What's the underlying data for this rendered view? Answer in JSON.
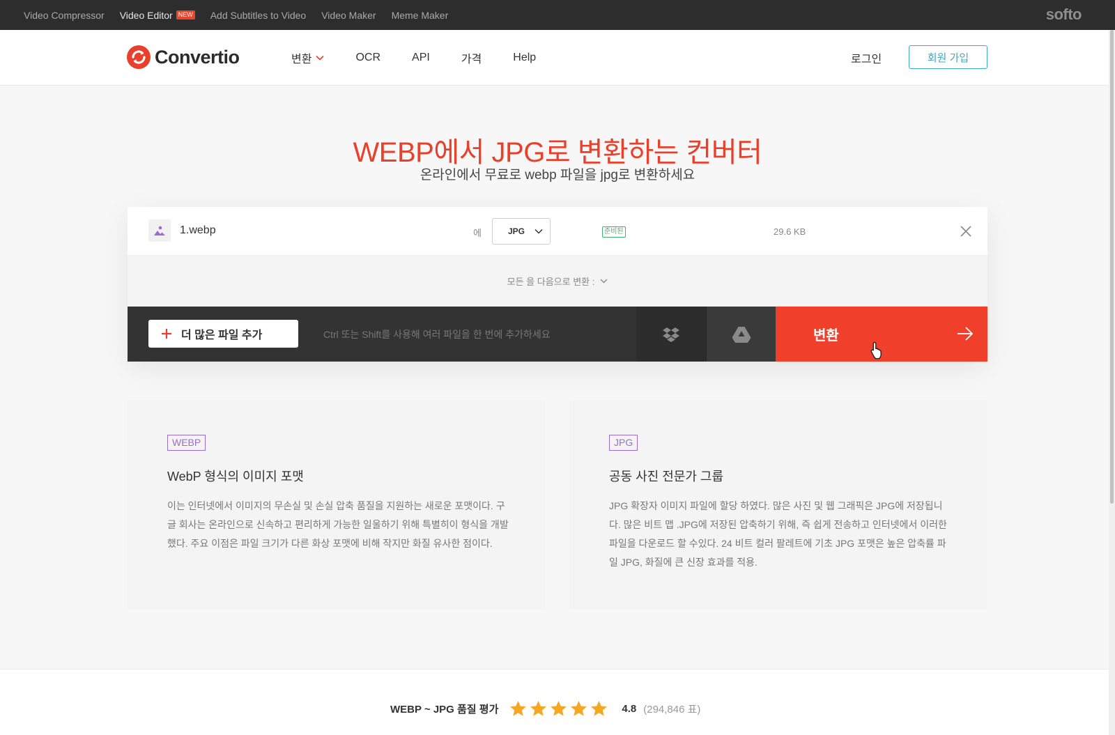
{
  "topbar": {
    "links": [
      {
        "label": "Video Compressor"
      },
      {
        "label": "Video Editor",
        "badge": "NEW"
      },
      {
        "label": "Add Subtitles to Video"
      },
      {
        "label": "Video Maker"
      },
      {
        "label": "Meme Maker"
      }
    ],
    "brand": "softo"
  },
  "header": {
    "logo_text": "Convertio",
    "nav": [
      {
        "label": "변환",
        "has_dropdown": true
      },
      {
        "label": "OCR"
      },
      {
        "label": "API"
      },
      {
        "label": "가격"
      },
      {
        "label": "Help"
      }
    ],
    "login": "로그인",
    "signup": "회원 가입"
  },
  "hero": {
    "title": "WEBP에서 JPG로 변환하는 컨버터",
    "subtitle": "온라인에서 무료로 webp 파일을 jpg로 변환하세요"
  },
  "converter": {
    "file": {
      "name": "1.webp",
      "to_label": "에",
      "format": "JPG",
      "status": "준비된",
      "size": "29.6 KB"
    },
    "convert_all_label": "모든 을 다음으로 변환 :",
    "add_files": "더 많은 파일 추가",
    "hint": "Ctrl 또는 Shift를 사용해 여러 파일을 한 번에 추가하세요",
    "convert_button": "변환"
  },
  "cards": [
    {
      "tag": "WEBP",
      "title": "WebP 형식의 이미지 포맷",
      "body": "이는 인터넷에서 이미지의 무손실 및 손실 압축 품질을 지원하는 새로운 포맷이다. 구글 회사는 온라인으로 신속하고 편리하게 가능한 일울하기 위해 특별히이 형식을 개발했다. 주요 이점은 파일 크기가 다른 화상 포맷에 비해 작지만 화질 유사한 점이다."
    },
    {
      "tag": "JPG",
      "title": "공동 사진 전문가 그룹",
      "body": "JPG 확장자 이미지 파일에 할당 하였다. 많은 사진 및 웹 그래픽은 JPG에 저장됩니다. 많은 비트 맵 .JPG에 저장된 압축하기 위해, 즉 쉽게 전송하고 인터넷에서 이러한 파일을 다운로드 할 수있다. 24 비트 컬러 팔레트에 기초 JPG 포맷은 높은 압축률 파일 JPG, 화질에 큰 신장 효과를 적용."
    }
  ],
  "rating": {
    "label": "WEBP ~ JPG 품질 평가",
    "stars": 5,
    "score": "4.8",
    "votes": "(294,846 표)"
  },
  "colors": {
    "accent": "#f0402b",
    "signup": "#3ea8c6",
    "status": "#3bb56a",
    "tag": "#9b6bcf",
    "star": "#f5a623"
  }
}
